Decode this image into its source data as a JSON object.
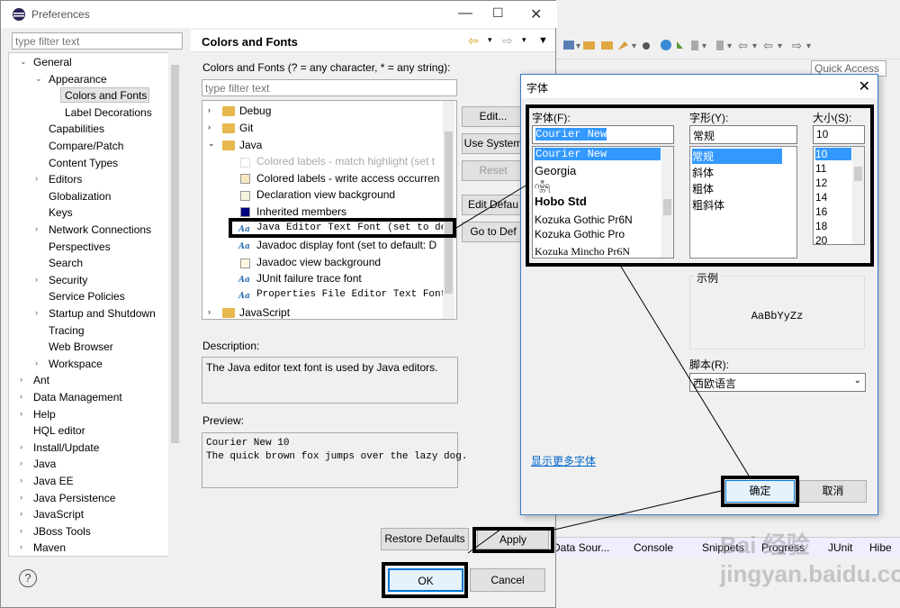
{
  "pref": {
    "title": "Preferences",
    "filter_placeholder": "type filter text",
    "tree": [
      "General",
      "Appearance",
      "Colors and Fonts",
      "Label Decorations",
      "Capabilities",
      "Compare/Patch",
      "Content Types",
      "Editors",
      "Globalization",
      "Keys",
      "Network Connections",
      "Perspectives",
      "Search",
      "Security",
      "Service Policies",
      "Startup and Shutdown",
      "Tracing",
      "Web Browser",
      "Workspace",
      "Ant",
      "Data Management",
      "Help",
      "HQL editor",
      "Install/Update",
      "Java",
      "Java EE",
      "Java Persistence",
      "JavaScript",
      "JBoss Tools",
      "Maven"
    ],
    "page_title": "Colors and Fonts",
    "cf_label": "Colors and Fonts (? = any character, * = any string):",
    "cf_filter_placeholder": "type filter text",
    "cf_items": [
      "Debug",
      "Git",
      "Java",
      "Colored labels - match highlight (set t",
      "Colored labels - write access occurren",
      "Declaration view background",
      "Inherited members",
      "Java Editor Text Font (set to de",
      "Javadoc display font (set to default: D",
      "Javadoc view background",
      "JUnit failure trace font",
      "Properties File Editor Text Font",
      "JavaScript"
    ],
    "buttons": {
      "edit": "Edit...",
      "use_system": "Use System",
      "reset": "Reset",
      "edit_default": "Edit Defau",
      "go_to_default": "Go to Def",
      "restore_defaults": "Restore Defaults",
      "apply": "Apply",
      "ok": "OK",
      "cancel": "Cancel"
    },
    "description_label": "Description:",
    "description": "The Java editor text font is used by Java editors.",
    "preview_label": "Preview:",
    "preview_text": "Courier New 10\nThe quick brown fox jumps over the lazy dog.",
    "help_symbol": "?"
  },
  "bg": {
    "quick_access": "Quick Access",
    "tabs": [
      "Data Sour...",
      "Console",
      "Snippets",
      "Progress",
      "JUnit",
      "Hibe"
    ],
    "watermark": "Bai 经验 jingyan.baidu.com"
  },
  "font_dialog": {
    "title": "字体",
    "font_label": "字体(F):",
    "style_label": "字形(Y):",
    "size_label": "大小(S):",
    "font_value": "Courier New",
    "style_value": "常规",
    "size_value": "10",
    "fonts": [
      "Courier New",
      "Georgia",
      "ဂမ္ဘီရ",
      "Hobo Std",
      "Kozuka Gothic Pr6N",
      "Kozuka Gothic Pro",
      "Kozuka Mincho Pr6N"
    ],
    "styles": [
      "常规",
      "斜体",
      "粗体",
      "粗斜体"
    ],
    "sizes": [
      "10",
      "11",
      "12",
      "14",
      "16",
      "18",
      "20"
    ],
    "sample_label": "示例",
    "sample_text": "AaBbYyZz",
    "script_label": "脚本(R):",
    "script_value": "西欧语言",
    "more_fonts": "显示更多字体",
    "ok": "确定",
    "cancel": "取消"
  }
}
